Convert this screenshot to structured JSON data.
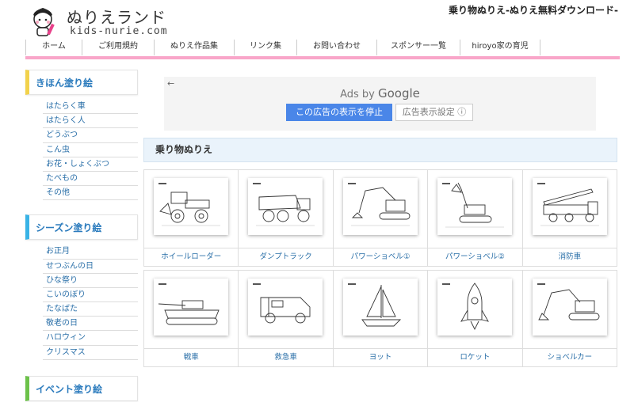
{
  "header": {
    "logo_title": "ぬりえランド",
    "logo_subtitle": "kids-nurie.com",
    "tagline": "乗り物ぬりえ-ぬりえ無料ダウンロード-"
  },
  "nav": [
    "ホーム",
    "ご利用規約",
    "ぬりえ作品集",
    "リンク集",
    "お問い合わせ",
    "スポンサー一覧",
    "hiroyo家の育児"
  ],
  "sidebar": {
    "sections": [
      {
        "title": "きほん塗り絵",
        "accent": "#f2d24b",
        "items": [
          "はたらく車",
          "はたらく人",
          "どうぶつ",
          "こん虫",
          "お花・しょくぶつ",
          "たべもの",
          "その他"
        ]
      },
      {
        "title": "シーズン塗り絵",
        "accent": "#39b3e6",
        "items": [
          "お正月",
          "せつぶんの日",
          "ひな祭り",
          "こいのぼり",
          "たなばた",
          "敬老の日",
          "ハロウィン",
          "クリスマス"
        ]
      },
      {
        "title": "イベント塗り絵",
        "accent": "#6cc24a",
        "items": []
      }
    ]
  },
  "ad": {
    "back": "←",
    "title_prefix": "Ads by ",
    "title_brand": "Google",
    "stop_button": "この広告の表示を停止",
    "settings_button": "広告表示設定 ⓘ"
  },
  "section_title": "乗り物ぬりえ",
  "cards_row1": [
    {
      "label": "ホイールローダー",
      "icon": "wheel-loader-icon"
    },
    {
      "label": "ダンプトラック",
      "icon": "dump-truck-icon"
    },
    {
      "label": "パワーショベル①",
      "icon": "power-shovel-icon"
    },
    {
      "label": "パワーショベル②",
      "icon": "power-shovel-icon"
    },
    {
      "label": "消防車",
      "icon": "fire-truck-icon"
    }
  ],
  "cards_row2": [
    {
      "label": "戦車",
      "icon": "tank-icon"
    },
    {
      "label": "救急車",
      "icon": "ambulance-icon"
    },
    {
      "label": "ヨット",
      "icon": "yacht-icon"
    },
    {
      "label": "ロケット",
      "icon": "rocket-icon"
    },
    {
      "label": "ショベルカー",
      "icon": "excavator-icon"
    }
  ],
  "colors": {
    "pink_bar": "#f9a6c9",
    "link": "#2a6fa8",
    "ad_button": "#4a86e8"
  }
}
